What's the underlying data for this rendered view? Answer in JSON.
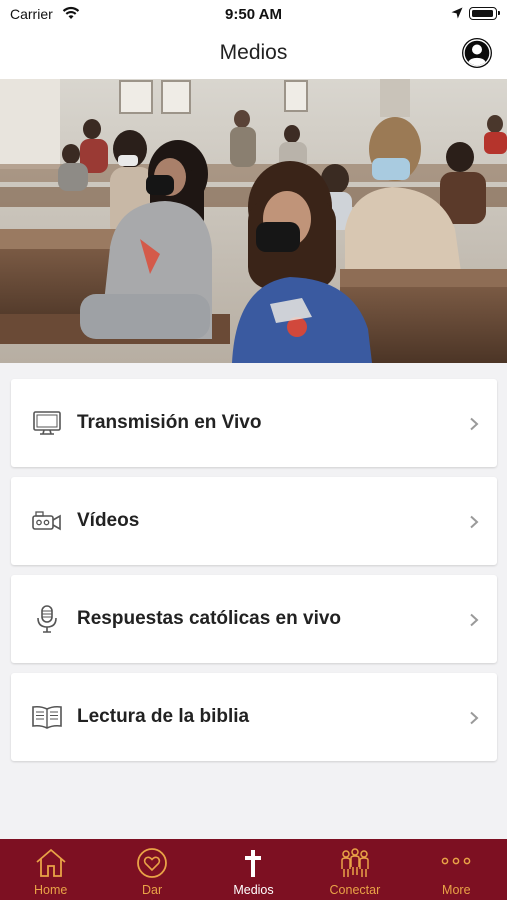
{
  "status_bar": {
    "carrier": "Carrier",
    "time": "9:50 AM"
  },
  "nav": {
    "title": "Medios"
  },
  "hero": {
    "description_icon": "photo"
  },
  "menu": {
    "items": [
      {
        "label": "Transmisión en Vivo",
        "icon": "tv-icon"
      },
      {
        "label": "Vídeos",
        "icon": "video-camera-icon"
      },
      {
        "label": "Respuestas católicas en vivo",
        "icon": "microphone-icon"
      },
      {
        "label": "Lectura de la biblia",
        "icon": "book-icon"
      }
    ]
  },
  "tabs": [
    {
      "label": "Home",
      "icon": "home-icon",
      "active": false
    },
    {
      "label": "Dar",
      "icon": "heart-icon",
      "active": false
    },
    {
      "label": "Medios",
      "icon": "cross-icon",
      "active": true
    },
    {
      "label": "Conectar",
      "icon": "people-icon",
      "active": false
    },
    {
      "label": "More",
      "icon": "more-icon",
      "active": false
    }
  ],
  "colors": {
    "tab_bar": "#7d1022",
    "tab_inactive": "#e9a347",
    "tab_active": "#ffffff",
    "background": "#f2f2f4"
  }
}
